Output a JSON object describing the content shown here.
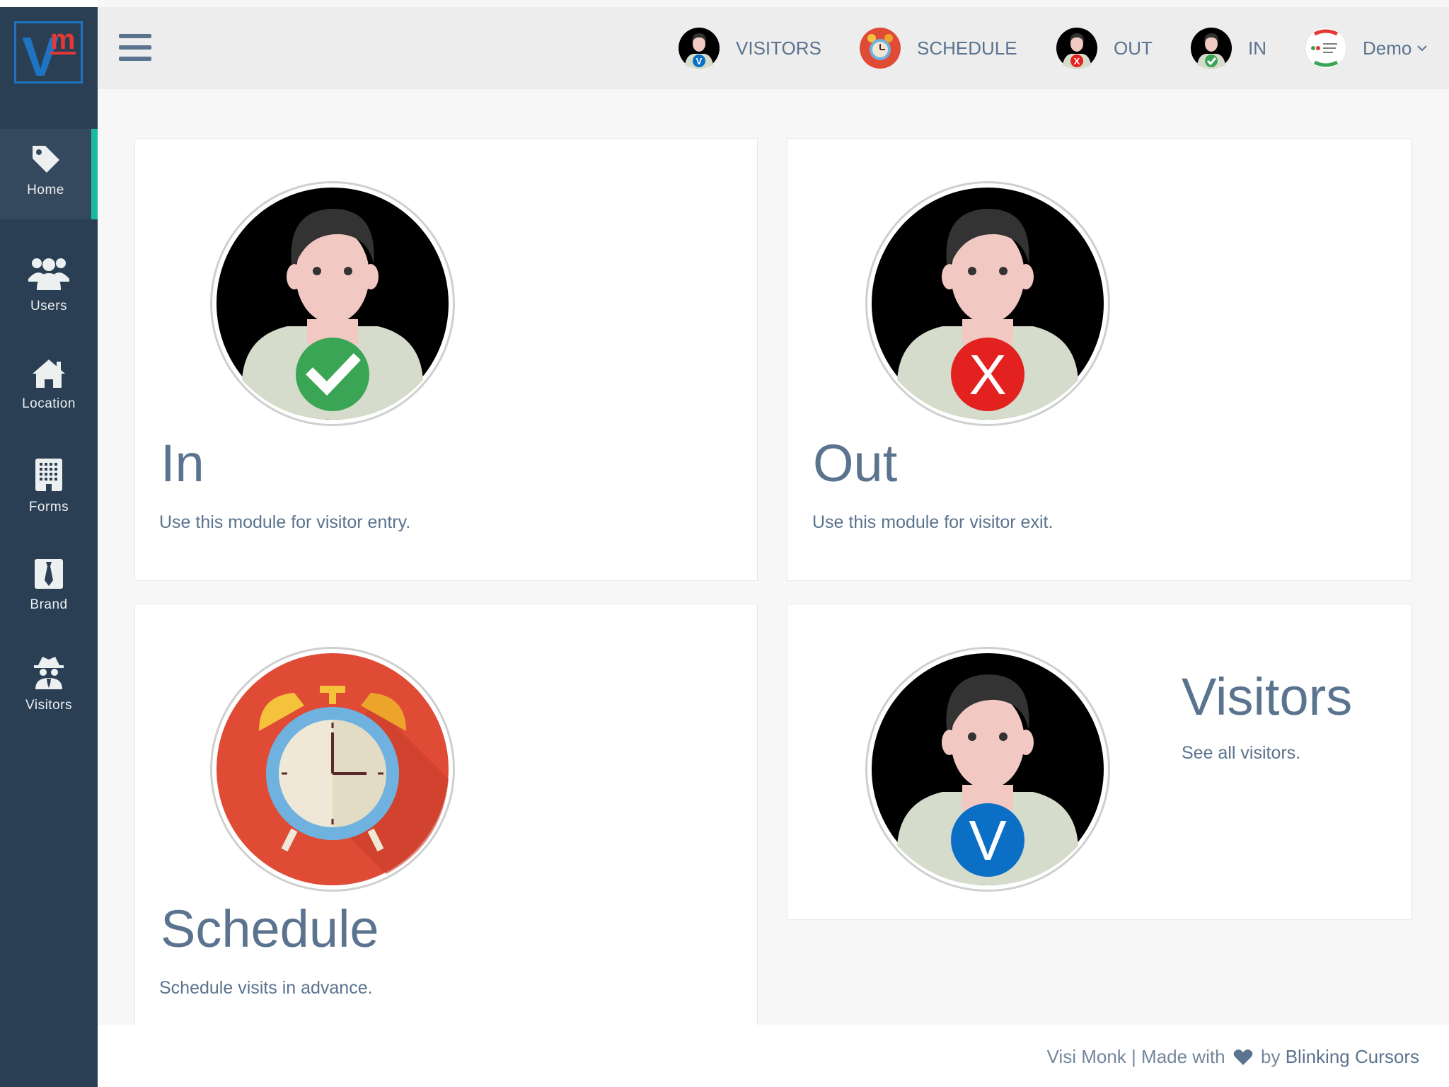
{
  "sidebar": {
    "logo_text": "V",
    "logo_sup": "m",
    "items": [
      {
        "label": "Home",
        "icon": "tag-icon"
      },
      {
        "label": "Users",
        "icon": "users-icon"
      },
      {
        "label": "Location",
        "icon": "home-icon"
      },
      {
        "label": "Forms",
        "icon": "building-icon"
      },
      {
        "label": "Brand",
        "icon": "tie-icon"
      },
      {
        "label": "Visitors",
        "icon": "spy-icon"
      }
    ]
  },
  "topbar": {
    "menu_icon": "hamburger-icon",
    "nav": [
      {
        "label": "VISITORS",
        "icon": "visitor-v-avatar-icon"
      },
      {
        "label": "SCHEDULE",
        "icon": "alarm-clock-icon"
      },
      {
        "label": "OUT",
        "icon": "visitor-out-avatar-icon"
      },
      {
        "label": "IN",
        "icon": "visitor-in-avatar-icon"
      }
    ],
    "user": {
      "label": "Demo",
      "icon": "user-avatar-icon"
    }
  },
  "panels": [
    {
      "title": "In",
      "description": "Use this module for visitor entry."
    },
    {
      "title": "Out",
      "description": "Use this module for visitor exit."
    },
    {
      "title": "Schedule",
      "description": "Schedule visits in advance."
    },
    {
      "title": "Visitors",
      "description": "See all visitors."
    }
  ],
  "footer": {
    "app_name": "Visi Monk",
    "separator": "|",
    "made_with": "Made with",
    "by": "by",
    "company": "Blinking Cursors"
  },
  "colors": {
    "sidebar_bg": "#2a3f54",
    "accent": "#1abb9c",
    "text": "#5a738e",
    "in_green": "#3aa655",
    "out_red": "#e3211f",
    "visitor_blue": "#0b6fc6",
    "clock_red": "#e04b36"
  }
}
